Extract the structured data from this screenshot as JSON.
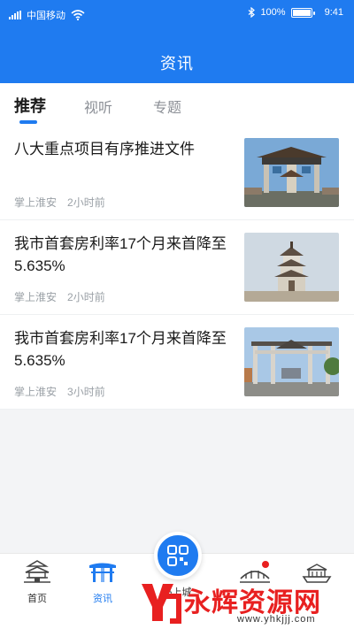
{
  "status_bar": {
    "carrier": "中国移动",
    "battery": "100%",
    "time": "9:41"
  },
  "header": {
    "title": "资讯"
  },
  "tabs": [
    {
      "label": "推荐",
      "active": true
    },
    {
      "label": "视听",
      "active": false
    },
    {
      "label": "专题",
      "active": false
    }
  ],
  "articles": [
    {
      "title": "八大重点项目有序推进文件",
      "source": "掌上淮安",
      "time": "2小时前",
      "image": "memorial-archway"
    },
    {
      "title": "我市首套房利率17个月来首降至5.635%",
      "source": "掌上淮安",
      "time": "2小时前",
      "image": "pagoda-tower"
    },
    {
      "title": "我市首套房利率17个月来首降至5.635%",
      "source": "掌上淮安",
      "time": "3小时前",
      "image": "street-archway"
    }
  ],
  "bottom_nav": [
    {
      "label": "首页",
      "icon": "pagoda-icon"
    },
    {
      "label": "资讯",
      "icon": "gate-icon",
      "active": true
    },
    {
      "label": "码上城",
      "icon": "qr-code-icon"
    },
    {
      "label": "",
      "icon": "bridge-icon"
    },
    {
      "label": "",
      "icon": "boat-icon"
    }
  ],
  "watermark": {
    "text": "永辉资源网",
    "url": "www.yhkjjj.com"
  },
  "colors": {
    "primary": "#1f7bf0",
    "watermark": "#e82020"
  }
}
